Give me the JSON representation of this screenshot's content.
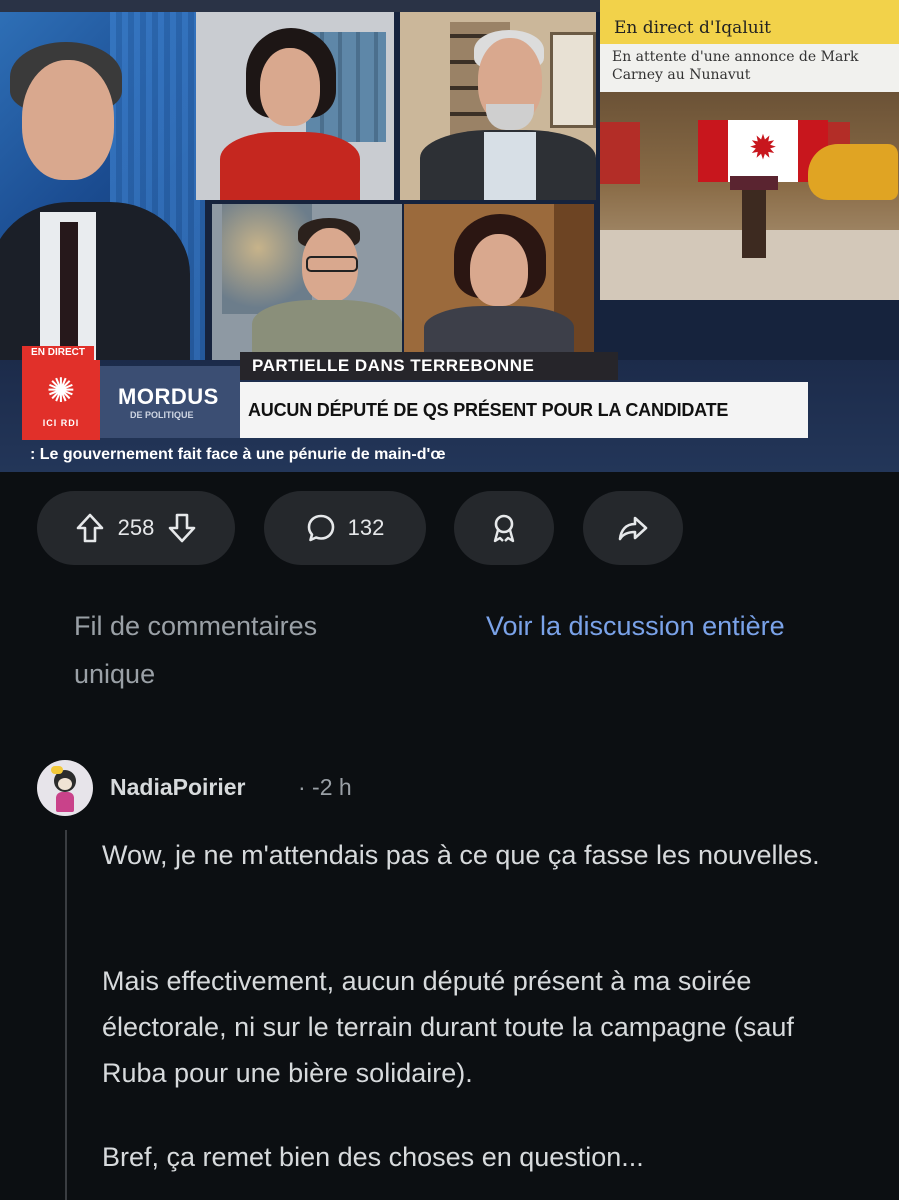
{
  "broadcast": {
    "live_badge": "EN DIRECT",
    "network_label": "ICI RDI",
    "show_name": "MORDUS",
    "show_subtitle": "DE POLITIQUE",
    "topic": "PARTIELLE DANS TERREBONNE",
    "headline": "AUCUN DÉPUTÉ DE QS PRÉSENT POUR LA CANDIDATE",
    "ticker": ": Le gouvernement fait face à une pénurie de main-d'œ",
    "side_header": "En direct d'Iqaluit",
    "side_caption": "En attente d'une annonce de Mark Carney au Nunavut"
  },
  "actions": {
    "upvotes": "258",
    "comments": "132",
    "upvote_icon": "arrow-up-icon",
    "downvote_icon": "arrow-down-icon",
    "comment_icon": "speech-bubble-icon",
    "award_icon": "award-ribbon-icon",
    "share_icon": "share-arrow-icon"
  },
  "thread_links": {
    "single": "Fil de commentaires unique",
    "full": "Voir la discussion entière"
  },
  "comment": {
    "username": "NadiaPoirier",
    "meta": "· -2 h",
    "paragraphs": [
      "Wow, je ne m'attendais pas à ce que ça fasse les nouvelles.",
      "Mais effectivement, aucun député présent à ma soirée électorale, ni sur le terrain durant toute la campagne (sauf Ruba pour une bière solidaire).",
      "Bref, ça remet bien des choses en question..."
    ]
  },
  "colors": {
    "background": "#0c0f12",
    "pill": "#25282c",
    "link_blue": "#7aa2e8",
    "cbc_red": "#e1302a",
    "ticker_bg": "#233659"
  }
}
